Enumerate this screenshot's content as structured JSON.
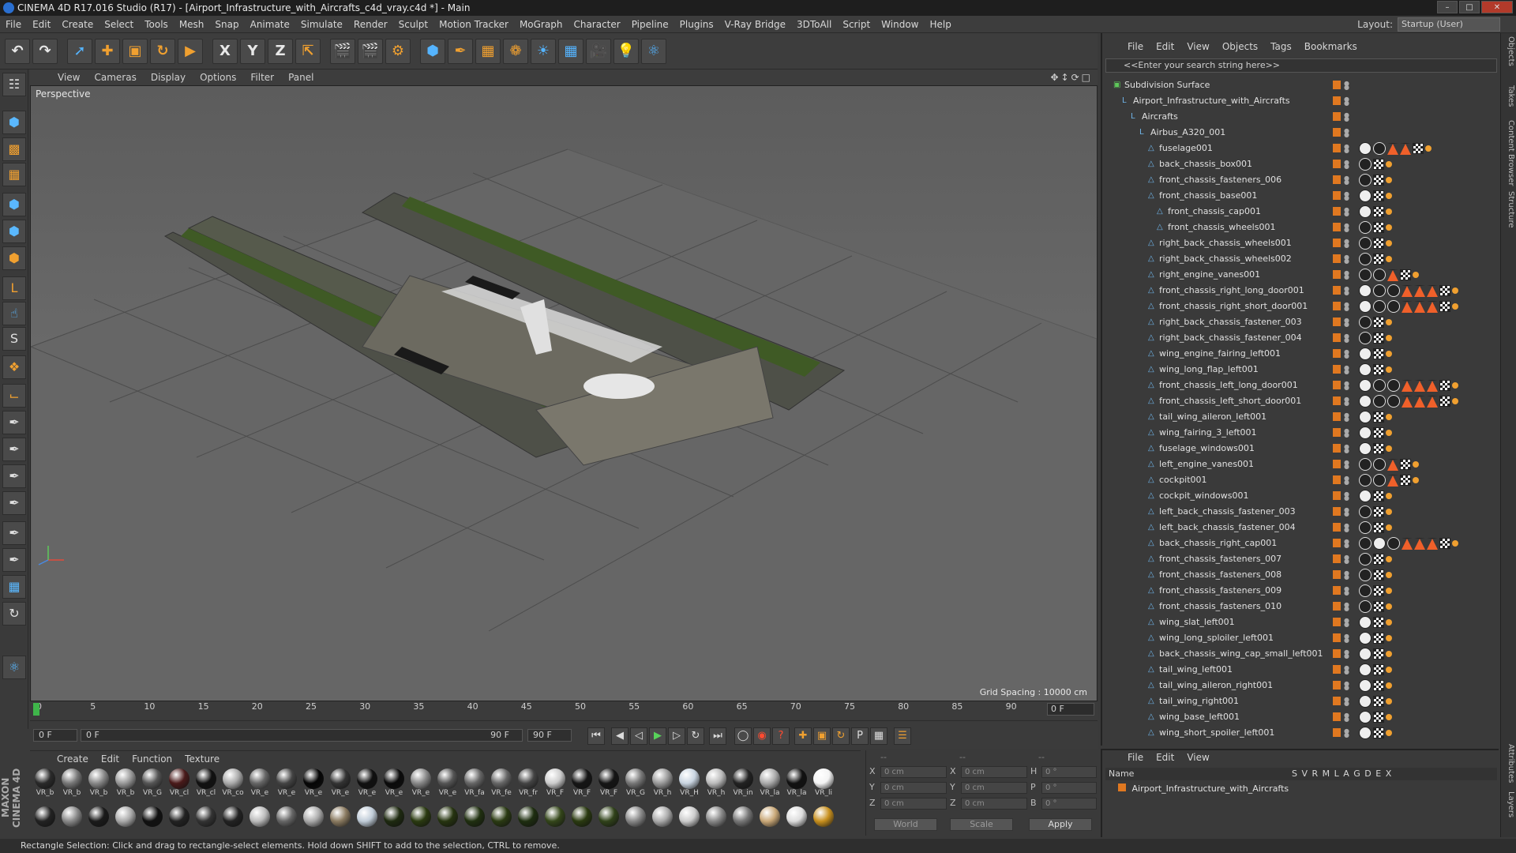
{
  "window": {
    "title": "CINEMA 4D R17.016 Studio (R17) - [Airport_Infrastructure_with_Aircrafts_c4d_vray.c4d *] - Main"
  },
  "menubar": [
    "File",
    "Edit",
    "Create",
    "Select",
    "Tools",
    "Mesh",
    "Snap",
    "Animate",
    "Simulate",
    "Render",
    "Sculpt",
    "Motion Tracker",
    "MoGraph",
    "Character",
    "Pipeline",
    "Plugins",
    "V-Ray Bridge",
    "3DToAll",
    "Script",
    "Window",
    "Help"
  ],
  "layout": {
    "label": "Layout:",
    "value": "Startup (User)"
  },
  "viewport": {
    "menu": [
      "View",
      "Cameras",
      "Display",
      "Options",
      "Filter",
      "Panel"
    ],
    "label": "Perspective",
    "grid_spacing": "Grid Spacing : 10000 cm"
  },
  "timeline": {
    "ticks": [
      "0",
      "5",
      "10",
      "15",
      "20",
      "25",
      "30",
      "35",
      "40",
      "45",
      "50",
      "55",
      "60",
      "65",
      "70",
      "75",
      "80",
      "85",
      "90"
    ],
    "current_frame": "0 F"
  },
  "playback": {
    "start": "0 F",
    "range_start": "0 F",
    "range_end": "90 F",
    "end": "90 F"
  },
  "materials": {
    "menu": [
      "Create",
      "Edit",
      "Function",
      "Texture"
    ],
    "row1": [
      "VR_b",
      "VR_b",
      "VR_b",
      "VR_b",
      "VR_G",
      "VR_cl",
      "VR_cl",
      "VR_co",
      "VR_e",
      "VR_e",
      "VR_e",
      "VR_e",
      "VR_e",
      "VR_e",
      "VR_e",
      "VR_e",
      "VR_fa",
      "VR_fe",
      "VR_fr",
      "VR_F",
      "VR_F",
      "VR_F",
      "VR_G",
      "VR_h",
      "VR_H",
      "VR_h",
      "VR_in",
      "VR_la",
      "VR_la",
      "VR_li"
    ],
    "row1_colors": [
      "#2a2a2a",
      "#777",
      "#888",
      "#999",
      "#555",
      "#4a1a1a",
      "#111",
      "#aaa",
      "#666",
      "#444",
      "#050505",
      "#333",
      "#101010",
      "#0a0a0a",
      "#888",
      "#555",
      "#666",
      "#666",
      "#444",
      "#ccc",
      "#151515",
      "#151515",
      "#777",
      "#999",
      "#c8d4e0",
      "#bbb",
      "#222",
      "#aaa",
      "#111",
      "#f4f4f4"
    ],
    "row2_colors": [
      "#222",
      "#888",
      "#1a1a1a",
      "#aaa",
      "#111",
      "#222",
      "#333",
      "#222",
      "#bbb",
      "#666",
      "#aaa",
      "#8a7a60",
      "#c0ccd8",
      "#1e2a10",
      "#2a3a10",
      "#263410",
      "#203010",
      "#2a3a12",
      "#1e2e10",
      "#34461a",
      "#2a3a10",
      "#30421a",
      "#888",
      "#aaa",
      "#ccc",
      "#888",
      "#777",
      "#c9a878",
      "#ddd",
      "#c8901e"
    ]
  },
  "coords": {
    "rows": [
      {
        "a": "X",
        "av": "0 cm",
        "b": "X",
        "bv": "0 cm",
        "c": "H",
        "cv": "0 °"
      },
      {
        "a": "Y",
        "av": "0 cm",
        "b": "Y",
        "bv": "0 cm",
        "c": "P",
        "cv": "0 °"
      },
      {
        "a": "Z",
        "av": "0 cm",
        "b": "Z",
        "bv": "0 cm",
        "c": "B",
        "cv": "0 °"
      }
    ],
    "headers": [
      "--",
      "--",
      "--"
    ],
    "world": "World",
    "scale": "Scale",
    "apply": "Apply"
  },
  "objects": {
    "menu": [
      "File",
      "Edit",
      "View",
      "Objects",
      "Tags",
      "Bookmarks"
    ],
    "search_placeholder": "<<Enter your search string here>>",
    "items": [
      {
        "name": "Subdivision Surface",
        "indent": 0,
        "icon": "subdivision-icon",
        "tags": []
      },
      {
        "name": "Airport_Infrastructure_with_Aircrafts",
        "indent": 1,
        "icon": "null-icon",
        "tags": []
      },
      {
        "name": "Aircrafts",
        "indent": 2,
        "icon": "null-icon",
        "tags": []
      },
      {
        "name": "Airbus_A320_001",
        "indent": 3,
        "icon": "null-icon",
        "tags": []
      },
      {
        "name": "fuselage001",
        "indent": 4,
        "icon": "polygon-icon",
        "tags": [
          "w",
          "d",
          "t",
          "t",
          "c",
          "s"
        ]
      },
      {
        "name": "back_chassis_box001",
        "indent": 4,
        "icon": "polygon-icon",
        "tags": [
          "d",
          "c",
          "s"
        ]
      },
      {
        "name": "front_chassis_fasteners_006",
        "indent": 4,
        "icon": "polygon-icon",
        "tags": [
          "d",
          "c",
          "s"
        ]
      },
      {
        "name": "front_chassis_base001",
        "indent": 4,
        "icon": "polygon-icon",
        "tags": [
          "w",
          "c",
          "s"
        ]
      },
      {
        "name": "front_chassis_cap001",
        "indent": 5,
        "icon": "polygon-icon",
        "tags": [
          "w",
          "c",
          "s"
        ]
      },
      {
        "name": "front_chassis_wheels001",
        "indent": 5,
        "icon": "polygon-icon",
        "tags": [
          "d",
          "c",
          "s"
        ]
      },
      {
        "name": "right_back_chassis_wheels001",
        "indent": 4,
        "icon": "polygon-icon",
        "tags": [
          "d",
          "c",
          "s"
        ]
      },
      {
        "name": "right_back_chassis_wheels002",
        "indent": 4,
        "icon": "polygon-icon",
        "tags": [
          "d",
          "c",
          "s"
        ]
      },
      {
        "name": "right_engine_vanes001",
        "indent": 4,
        "icon": "polygon-icon",
        "tags": [
          "d",
          "d",
          "t",
          "c",
          "s"
        ]
      },
      {
        "name": "front_chassis_right_long_door001",
        "indent": 4,
        "icon": "polygon-icon",
        "tags": [
          "w",
          "d",
          "d",
          "t",
          "t",
          "t",
          "c",
          "s"
        ]
      },
      {
        "name": "front_chassis_right_short_door001",
        "indent": 4,
        "icon": "polygon-icon",
        "tags": [
          "w",
          "d",
          "d",
          "t",
          "t",
          "t",
          "c",
          "s"
        ]
      },
      {
        "name": "right_back_chassis_fastener_003",
        "indent": 4,
        "icon": "polygon-icon",
        "tags": [
          "d",
          "c",
          "s"
        ]
      },
      {
        "name": "right_back_chassis_fastener_004",
        "indent": 4,
        "icon": "polygon-icon",
        "tags": [
          "d",
          "c",
          "s"
        ]
      },
      {
        "name": "wing_engine_fairing_left001",
        "indent": 4,
        "icon": "polygon-icon",
        "tags": [
          "w",
          "c",
          "s"
        ]
      },
      {
        "name": "wing_long_flap_left001",
        "indent": 4,
        "icon": "polygon-icon",
        "tags": [
          "w",
          "c",
          "s"
        ]
      },
      {
        "name": "front_chassis_left_long_door001",
        "indent": 4,
        "icon": "polygon-icon",
        "tags": [
          "w",
          "d",
          "d",
          "t",
          "t",
          "t",
          "c",
          "s"
        ]
      },
      {
        "name": "front_chassis_left_short_door001",
        "indent": 4,
        "icon": "polygon-icon",
        "tags": [
          "w",
          "d",
          "d",
          "t",
          "t",
          "t",
          "c",
          "s"
        ]
      },
      {
        "name": "tail_wing_aileron_left001",
        "indent": 4,
        "icon": "polygon-icon",
        "tags": [
          "w",
          "c",
          "s"
        ]
      },
      {
        "name": "wing_fairing_3_left001",
        "indent": 4,
        "icon": "polygon-icon",
        "tags": [
          "w",
          "c",
          "s"
        ]
      },
      {
        "name": "fuselage_windows001",
        "indent": 4,
        "icon": "polygon-icon",
        "tags": [
          "w",
          "c",
          "s"
        ]
      },
      {
        "name": "left_engine_vanes001",
        "indent": 4,
        "icon": "polygon-icon",
        "tags": [
          "d",
          "d",
          "t",
          "c",
          "s"
        ]
      },
      {
        "name": "cockpit001",
        "indent": 4,
        "icon": "polygon-icon",
        "tags": [
          "d",
          "d",
          "t",
          "c",
          "s"
        ]
      },
      {
        "name": "cockpit_windows001",
        "indent": 4,
        "icon": "polygon-icon",
        "tags": [
          "w",
          "c",
          "s"
        ]
      },
      {
        "name": "left_back_chassis_fastener_003",
        "indent": 4,
        "icon": "polygon-icon",
        "tags": [
          "d",
          "c",
          "s"
        ]
      },
      {
        "name": "left_back_chassis_fastener_004",
        "indent": 4,
        "icon": "polygon-icon",
        "tags": [
          "d",
          "c",
          "s"
        ]
      },
      {
        "name": "back_chassis_right_cap001",
        "indent": 4,
        "icon": "polygon-icon",
        "tags": [
          "d",
          "w",
          "d",
          "t",
          "t",
          "t",
          "c",
          "s"
        ]
      },
      {
        "name": "front_chassis_fasteners_007",
        "indent": 4,
        "icon": "polygon-icon",
        "tags": [
          "d",
          "c",
          "s"
        ]
      },
      {
        "name": "front_chassis_fasteners_008",
        "indent": 4,
        "icon": "polygon-icon",
        "tags": [
          "d",
          "c",
          "s"
        ]
      },
      {
        "name": "front_chassis_fasteners_009",
        "indent": 4,
        "icon": "polygon-icon",
        "tags": [
          "d",
          "c",
          "s"
        ]
      },
      {
        "name": "front_chassis_fasteners_010",
        "indent": 4,
        "icon": "polygon-icon",
        "tags": [
          "d",
          "c",
          "s"
        ]
      },
      {
        "name": "wing_slat_left001",
        "indent": 4,
        "icon": "polygon-icon",
        "tags": [
          "w",
          "c",
          "s"
        ]
      },
      {
        "name": "wing_long_sploiler_left001",
        "indent": 4,
        "icon": "polygon-icon",
        "tags": [
          "w",
          "c",
          "s"
        ]
      },
      {
        "name": "back_chassis_wing_cap_small_left001",
        "indent": 4,
        "icon": "polygon-icon",
        "tags": [
          "w",
          "c",
          "s"
        ]
      },
      {
        "name": "tail_wing_left001",
        "indent": 4,
        "icon": "polygon-icon",
        "tags": [
          "w",
          "c",
          "s"
        ]
      },
      {
        "name": "tail_wing_aileron_right001",
        "indent": 4,
        "icon": "polygon-icon",
        "tags": [
          "w",
          "c",
          "s"
        ]
      },
      {
        "name": "tail_wing_right001",
        "indent": 4,
        "icon": "polygon-icon",
        "tags": [
          "w",
          "c",
          "s"
        ]
      },
      {
        "name": "wing_base_left001",
        "indent": 4,
        "icon": "polygon-icon",
        "tags": [
          "w",
          "c",
          "s"
        ]
      },
      {
        "name": "wing_short_spoiler_left001",
        "indent": 4,
        "icon": "polygon-icon",
        "tags": [
          "w",
          "c",
          "s"
        ]
      }
    ]
  },
  "attributes": {
    "menu": [
      "File",
      "Edit",
      "View"
    ],
    "columns": {
      "name": "Name",
      "flags": "S  V  R  M  L  A  G  D  E  X"
    },
    "row": "Airport_Infrastructure_with_Aircrafts"
  },
  "vertical_tabs": [
    "Objects",
    "Takes",
    "Content Browser",
    "Structure",
    "Attributes",
    "Layers"
  ],
  "maxon_logo": "MAXON CINEMA 4D",
  "status": "Rectangle Selection: Click and drag to rectangle-select elements. Hold down SHIFT to add to the selection, CTRL to remove."
}
